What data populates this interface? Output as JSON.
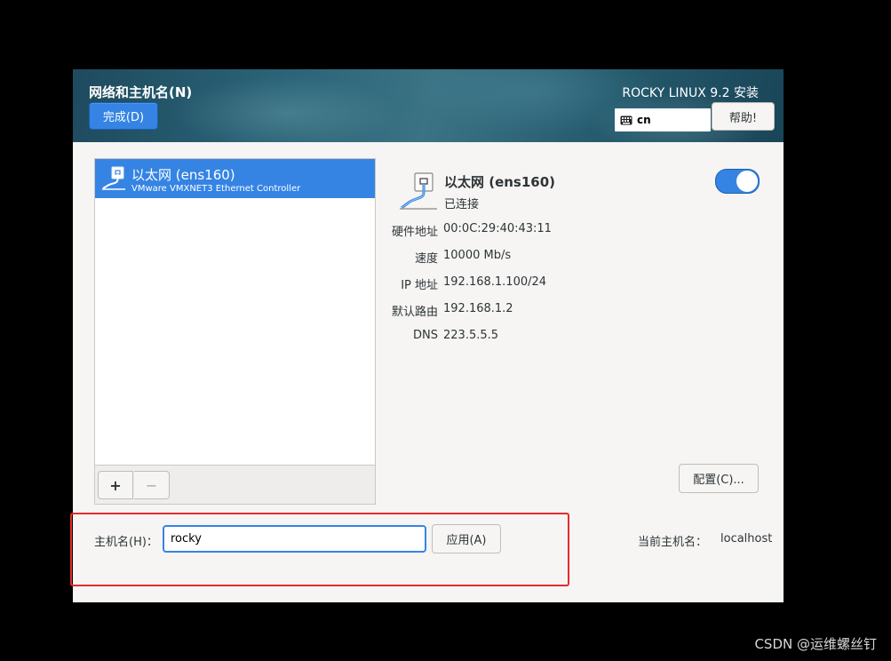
{
  "header": {
    "spoke_title": "网络和主机名(N)",
    "done_label": "完成(D)",
    "product_title": "ROCKY LINUX 9.2 安装",
    "keyboard_layout": "cn",
    "help_label": "帮助!"
  },
  "device_list": {
    "items": [
      {
        "name": "以太网 (ens160)",
        "description": "VMware VMXNET3 Ethernet Controller",
        "selected": true
      }
    ],
    "add_label": "+",
    "remove_label": "−"
  },
  "device_detail": {
    "name": "以太网 (ens160)",
    "status": "已连接",
    "enabled": true,
    "properties": [
      {
        "label": "硬件地址",
        "value": "00:0C:29:40:43:11"
      },
      {
        "label": "速度",
        "value": "10000 Mb/s"
      },
      {
        "label": "IP 地址",
        "value": "192.168.1.100/24"
      },
      {
        "label": "默认路由",
        "value": "192.168.1.2"
      },
      {
        "label": "DNS",
        "value": "223.5.5.5"
      }
    ],
    "configure_label": "配置(C)..."
  },
  "hostname": {
    "label": "主机名(H)：",
    "value": "rocky",
    "apply_label": "应用(A)",
    "current_label": "当前主机名：",
    "current_value": "localhost"
  },
  "colors": {
    "accent": "#3584e4",
    "highlight": "#e52b2b"
  },
  "watermark": "CSDN @运维螺丝钉"
}
